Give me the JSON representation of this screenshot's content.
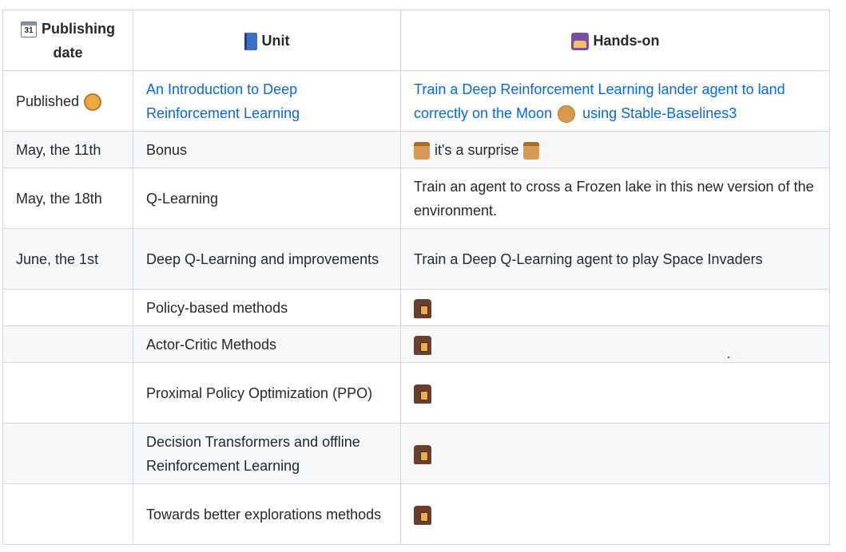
{
  "header": {
    "col1": "Publishing date",
    "col2": "Unit",
    "col3": "Hands-on",
    "icons": [
      "calendar-icon",
      "book-icon",
      "hands-on-icon"
    ]
  },
  "rows": [
    {
      "date": "Published",
      "unit": "An Introduction to Deep Reinforcement Learning",
      "hands_on_pre": "Train a Deep Reinforcement Learning lander agent to land correctly on the Moon",
      "hands_on_post": "using Stable-Baselines3"
    },
    {
      "date": "May, the 11th",
      "unit": "Bonus",
      "hands_on": "it's a surprise"
    },
    {
      "date": "May, the 18th",
      "unit": "Q-Learning",
      "hands_on": "Train an agent to cross a Frozen lake in this new version of the environment."
    },
    {
      "date": "June, the 1st",
      "unit": "Deep Q-Learning and improvements",
      "hands_on": "Train a Deep Q-Learning agent to play Space Invaders"
    },
    {
      "date": "",
      "unit": "Policy-based methods",
      "hands_on_icon": "under-construction-icon"
    },
    {
      "date": "",
      "unit": "Actor-Critic Methods",
      "hands_on_icon": "under-construction-icon"
    },
    {
      "date": "",
      "unit": "Proximal Policy Optimization (PPO)",
      "hands_on_icon": "under-construction-icon"
    },
    {
      "date": "",
      "unit": "Decision Transformers and offline Reinforcement Learning",
      "hands_on_icon": "under-construction-icon"
    },
    {
      "date": "",
      "unit": "Towards better explorations methods",
      "hands_on_icon": "under-construction-icon"
    }
  ],
  "colors": {
    "link": "#0969da",
    "border": "#d0d7de",
    "alt_row": "#f6f8fa",
    "text": "#24292f"
  }
}
